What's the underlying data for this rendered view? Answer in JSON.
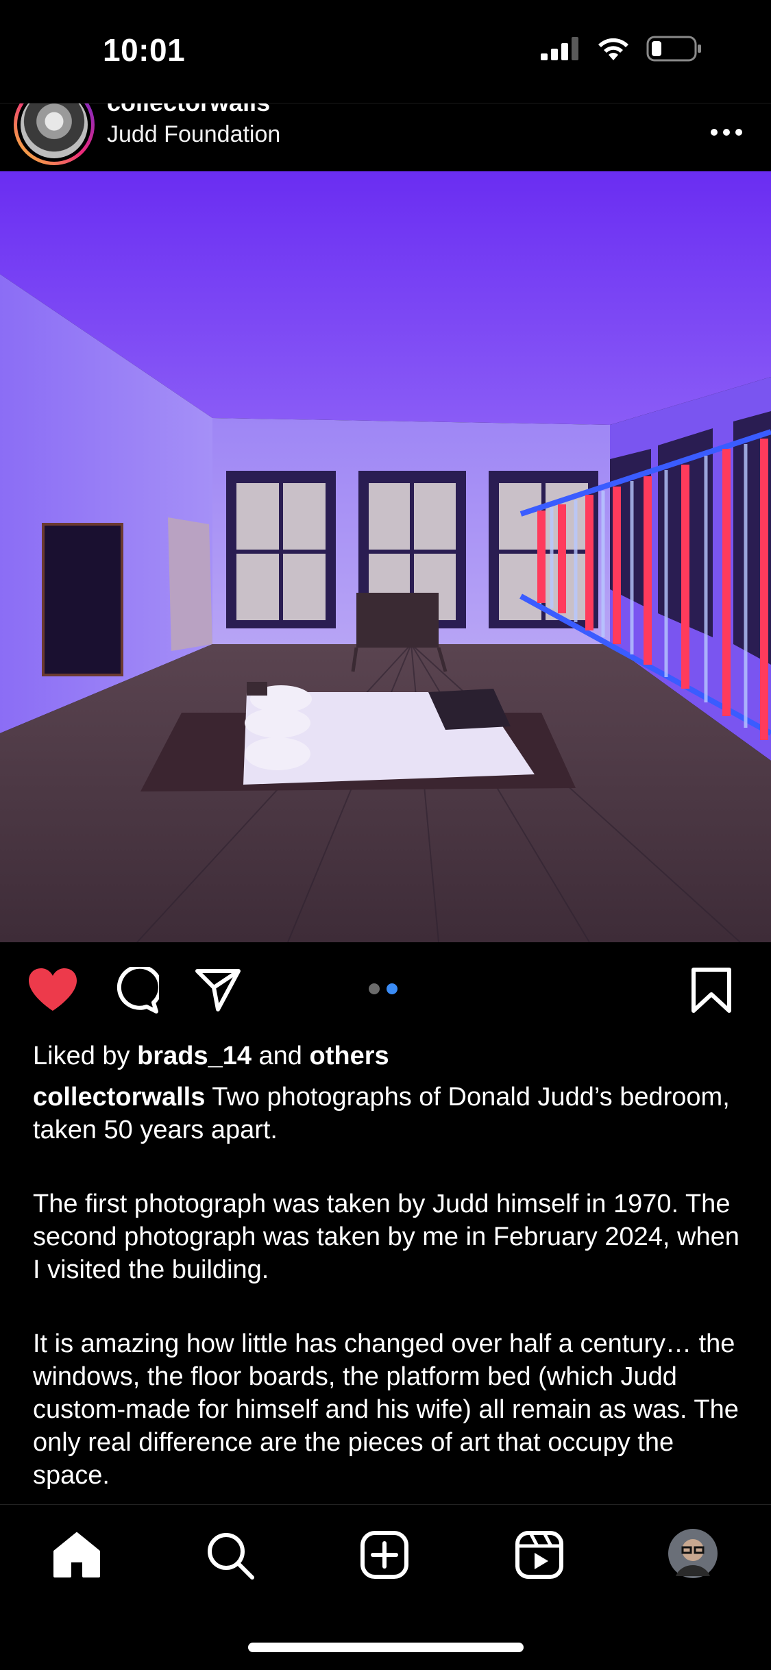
{
  "status": {
    "time": "10:01",
    "icons": [
      "signal-icon",
      "wifi-icon",
      "battery-icon"
    ]
  },
  "post": {
    "username": "collectorwalls",
    "location": "Judd Foundation",
    "more_icon": "more-icon",
    "carousel": {
      "count": 2,
      "active_index": 1
    },
    "liked": true
  },
  "likes": {
    "prefix": "Liked by ",
    "user": "brads_14",
    "middle": " and ",
    "suffix": "others"
  },
  "caption": {
    "username": "collectorwalls",
    "para1": " Two photographs of Donald Judd’s bedroom, taken 50 years apart.",
    "para2": "The first photograph was taken by Judd himself in 1970. The second photograph was taken by me in February 2024, when I visited the building.",
    "para3": "It is amazing how little has changed over half a century… the windows, the floor boards, the platform bed (which Judd custom-made for himself and his wife) all remain as was. The only real difference are the pieces of art that occupy the space."
  },
  "nav": {
    "items": [
      "home-icon",
      "search-icon",
      "create-icon",
      "reels-icon",
      "profile-avatar"
    ]
  },
  "colors": {
    "like": "#ed3a4b",
    "carousel_active": "#3b8cf6",
    "carousel_inactive": "#6b6b6b"
  }
}
